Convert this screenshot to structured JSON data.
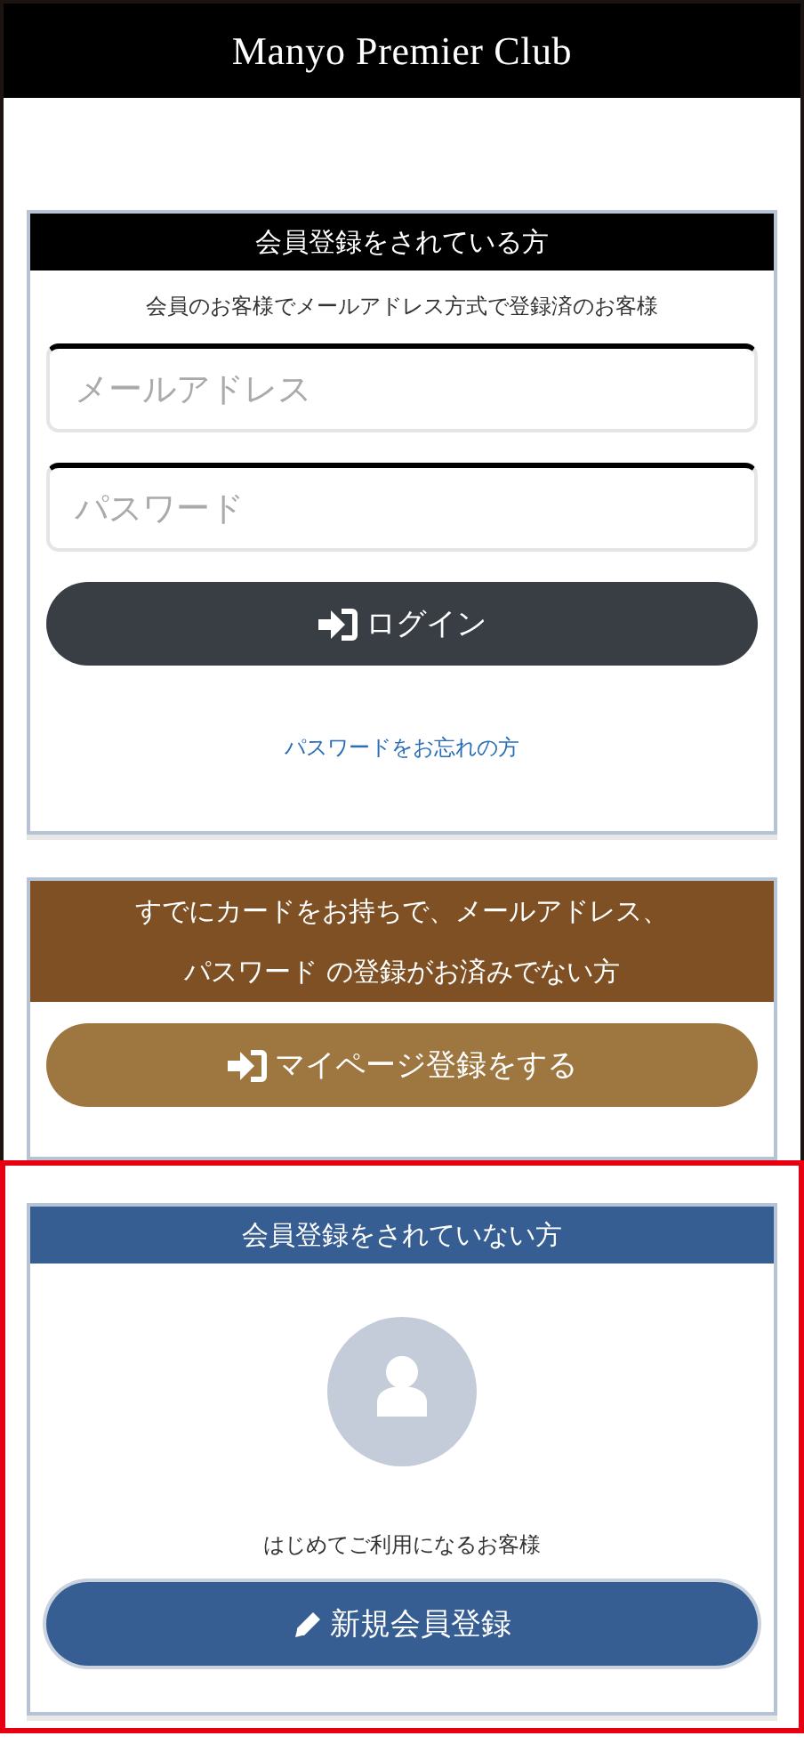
{
  "header": {
    "title": "Manyo Premier Club"
  },
  "cards": [
    {
      "title_lines": [
        "会員登録をされている方"
      ],
      "color": "#000000",
      "highlighted": false,
      "items": [
        {
          "kind": "note",
          "text": "会員のお客様でメールアドレス方式で登録済のお客様"
        },
        {
          "kind": "field",
          "placeholder": "メールアドレス"
        },
        {
          "kind": "field",
          "placeholder": "パスワード"
        },
        {
          "kind": "signin",
          "label": "ログイン",
          "color": "#393d44"
        },
        {
          "kind": "link",
          "text": "パスワードをお忘れの方"
        }
      ]
    },
    {
      "title_lines": [
        "すでにカードをお持ちで、メールアドレス、",
        "パスワード の登録がお済みでない方"
      ],
      "color": "#7e5024",
      "highlighted": false,
      "items": [
        {
          "kind": "signin",
          "label": "マイページ登録をする",
          "color": "#9e763f"
        }
      ]
    },
    {
      "title_lines": [
        "会員登録をされていない方"
      ],
      "color": "#375e92",
      "highlighted": true,
      "items": [
        {
          "kind": "avatar"
        },
        {
          "kind": "note",
          "text": "はじめてご利用になるお客様"
        },
        {
          "kind": "signup",
          "label": "新規会員登録",
          "color": "#375e92"
        }
      ]
    }
  ]
}
